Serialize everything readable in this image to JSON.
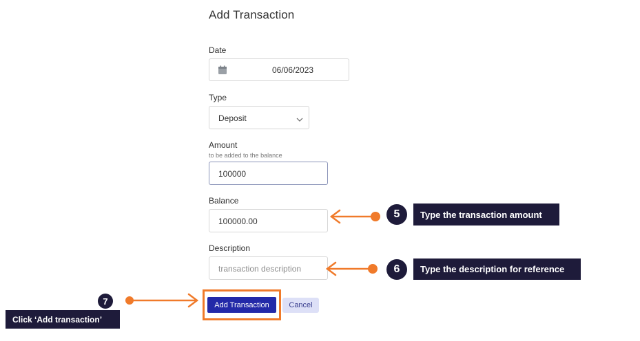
{
  "form": {
    "title": "Add Transaction",
    "date": {
      "label": "Date",
      "value": "06/06/2023",
      "icon": "calendar-icon"
    },
    "type": {
      "label": "Type",
      "value": "Deposit",
      "icon": "chevron-down-icon"
    },
    "amount": {
      "label": "Amount",
      "hint": "to be added to the balance",
      "value": "100000"
    },
    "balance": {
      "label": "Balance",
      "value": "100000.00"
    },
    "description": {
      "label": "Description",
      "placeholder": "transaction description"
    },
    "buttons": {
      "submit": "Add Transaction",
      "cancel": "Cancel"
    }
  },
  "annotations": {
    "step5": {
      "number": "5",
      "text": "Type the transaction amount"
    },
    "step6": {
      "number": "6",
      "text": "Type the description for reference"
    },
    "step7": {
      "number": "7",
      "text": "Click ‘Add transaction’"
    },
    "colors": {
      "accent": "#f07a2a",
      "callout_bg": "#1e1b3a",
      "primary_button": "#2329a8"
    }
  }
}
